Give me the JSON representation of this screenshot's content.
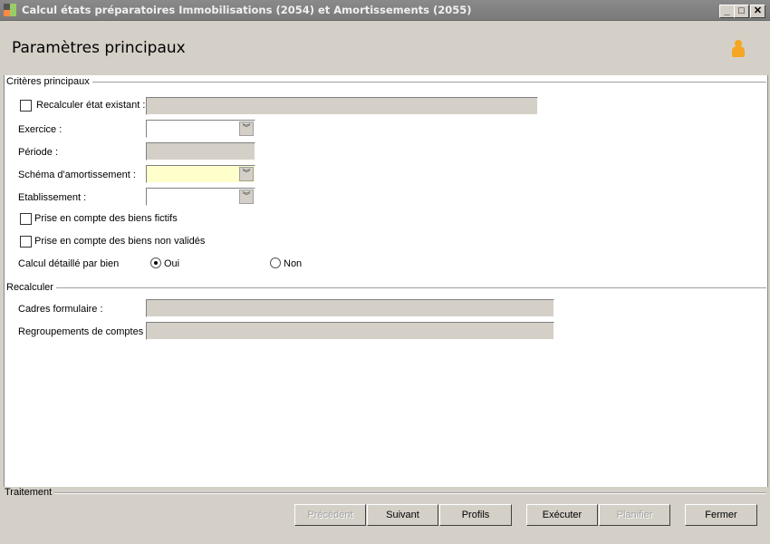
{
  "window": {
    "title": "Calcul états préparatoires Immobilisations (2054) et Amortissements (2055)",
    "minimize": "_",
    "maximize": "□",
    "close": "✕"
  },
  "header": {
    "title": "Paramètres principaux",
    "icon": "user-icon"
  },
  "criteres": {
    "group_label": "Critères principaux",
    "recalculer_label": "Recalculer état existant :",
    "recalculer_checked": false,
    "recalculer_value": "",
    "exercice_label": "Exercice :",
    "exercice_value": "",
    "periode_label": "Période :",
    "periode_value": "",
    "schema_label": "Schéma d'amortissement :",
    "schema_value": "",
    "schema_color": "#ffffcc",
    "etablissement_label": "Etablissement :",
    "etablissement_value": "",
    "fictifs_label": "Prise en compte des biens fictifs",
    "fictifs_checked": false,
    "non_valides_label": "Prise en compte des biens non validés",
    "non_valides_checked": false,
    "detail_label": "Calcul détaillé par bien",
    "oui_label": "Oui",
    "non_label": "Non",
    "detail_selected": "Oui"
  },
  "recalculer": {
    "group_label": "Recalculer",
    "cadres_label": "Cadres formulaire :",
    "cadres_value": "",
    "regroupements_label": "Regroupements de comptes :",
    "regroupements_value": ""
  },
  "traitement": {
    "group_label": "Traitement",
    "buttons": {
      "precedent": "Précédent",
      "suivant": "Suivant",
      "profils": "Profils",
      "executer": "Exécuter",
      "planifier": "Planifier",
      "fermer": "Fermer"
    }
  }
}
